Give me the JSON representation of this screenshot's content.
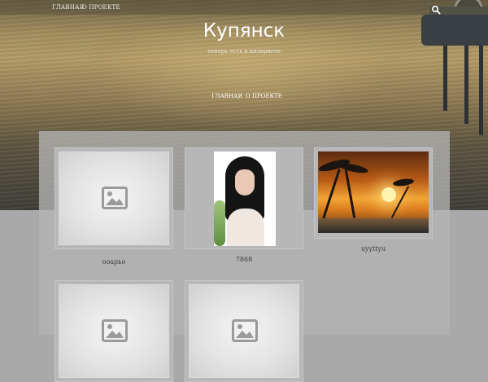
{
  "top_nav": {
    "items": [
      {
        "label": "ГЛАВНАЯ"
      },
      {
        "label": "О ПРОЕКТЕ"
      }
    ],
    "search_icon": "search-icon"
  },
  "site": {
    "title": "Купянск",
    "tagline": "теперь есть в интернете"
  },
  "main_nav": {
    "items": [
      {
        "label": "ГЛАВНАЯ"
      },
      {
        "label": "О ПРОЕКТЕ"
      }
    ]
  },
  "posts": [
    {
      "title": "ооарьо",
      "thumbnail": "placeholder-image-icon"
    },
    {
      "title": "7868",
      "thumbnail": "portrait-photo"
    },
    {
      "title": "uyyttyu",
      "thumbnail": "tropical-sunset-photo"
    },
    {
      "title": "",
      "thumbnail": "placeholder-image-icon"
    },
    {
      "title": "",
      "thumbnail": "placeholder-image-icon"
    }
  ],
  "colors": {
    "page_background": "#a9a9a9",
    "panel_background": "#b4b4b4",
    "title_text": "#ffffff"
  }
}
